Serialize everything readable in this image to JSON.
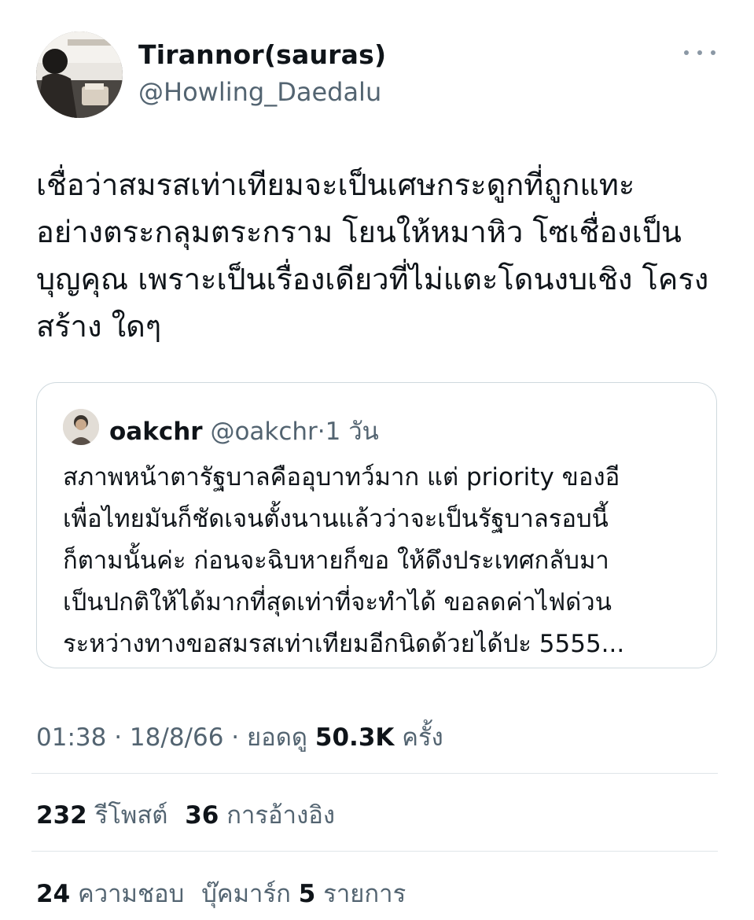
{
  "author": {
    "name": "Tirannor(sauras)",
    "handle": "@Howling_Daedalu",
    "avatar_icon": "person-photo-avatar"
  },
  "more_icon": "ellipsis-icon",
  "tweet_text_lines": [
    "เชื่อว่าสมรสเท่าเทียมจะเป็นเศษกระดูกที่ถูกแทะ",
    "อย่างตระกลุมตระกราม โยนให้หมาหิว โซเชื่องเป็น",
    "บุญคุณ เพราะเป็นเรื่องเดียวที่ไม่แตะโดนงบเชิง โครง",
    "สร้าง ใดๆ"
  ],
  "quoted_tweet": {
    "name": "oakchr",
    "handle": "@oakchr",
    "separator": "·",
    "time": "1 วัน",
    "avatar_icon": "person-photo-avatar",
    "text_lines": [
      "สภาพหน้าตารัฐบาลคืออุบาทว์มาก แต่ priority ของอี",
      "เพื่อไทยมันก็ชัดเจนตั้งนานแล้วว่าจะเป็นรัฐบาลรอบนี้",
      "ก็ตามนั้นค่ะ ก่อนจะฉิบหายก็ขอ ให้ดึงประเทศกลับมา",
      "เป็นปกติให้ได้มากที่สุดเท่าที่จะทำได้ ขอลดค่าไฟด่วน",
      "ระหว่างทางขอสมรสเท่าเทียมอีกนิดด้วยได้ปะ 5555..."
    ]
  },
  "meta": {
    "time": "01:38",
    "separator": "·",
    "date": "18/8/66",
    "views_label": "ยอดดู",
    "views_count": "50.3K",
    "views_suffix": "ครั้ง"
  },
  "stats_row1": {
    "retweets_count": "232",
    "retweets_label": "รีโพสต์",
    "quotes_count": "36",
    "quotes_label": "การอ้างอิง"
  },
  "stats_row2": {
    "likes_count": "24",
    "likes_label": "ความชอบ",
    "bookmarks_label": "บุ๊คมาร์ก",
    "bookmarks_count": "5",
    "bookmarks_suffix": "รายการ"
  },
  "colors": {
    "text_primary": "#0f1419",
    "text_secondary": "#536471",
    "border": "#cfd9de",
    "divider": "#dfe5e9"
  }
}
